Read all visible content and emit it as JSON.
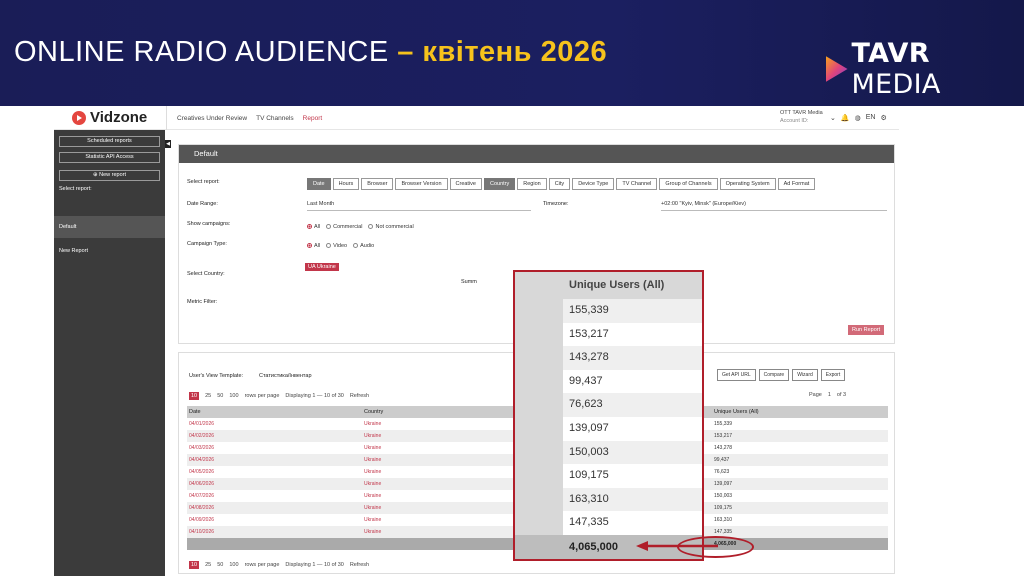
{
  "slide": {
    "title_main": "ONLINE RADIO AUDIENCE",
    "title_accent": "– квітень 2026",
    "brand_bold": "TAVR",
    "brand_light": "MEDIA",
    "colors": {
      "header_bg": "#1b1f60",
      "accent": "#f6c21c",
      "highlight": "#b01e2a"
    }
  },
  "app": {
    "logo": "Vidzone",
    "nav": [
      "Creatives Under Review",
      "TV Channels",
      "Report"
    ],
    "nav_active": "Report",
    "account_name": "OTT TAVR Media",
    "account_sub": "Account ID:",
    "lang": "EN",
    "icons": [
      "chevron-down-icon",
      "bell-icon",
      "globe-icon",
      "gear-icon"
    ]
  },
  "sidebar": {
    "buttons": [
      "Scheduled reports",
      "Statistic API Access",
      "⊕ New report"
    ],
    "select_label": "Select report:",
    "items": [
      "Default",
      "New Report"
    ]
  },
  "report": {
    "title": "Default",
    "select_report_label": "Select report:",
    "dimensions": [
      "Date",
      "Hours",
      "Browser",
      "Browser Version",
      "Creative",
      "Country",
      "Region",
      "City",
      "Device Type",
      "TV Channel",
      "Group of Channels",
      "Operating System",
      "Ad Format"
    ],
    "active_dimensions": [
      "Date",
      "Country"
    ],
    "date_range_label": "Date Range:",
    "date_range_value": "Last Month",
    "timezone_label": "Timezone:",
    "timezone_value": "+02:00 \"Kyiv, Minsk\" (Europe/Kiev)",
    "show_campaigns_label": "Show campaigns:",
    "show_campaigns_options": [
      "All",
      "Commercial",
      "Not commercial"
    ],
    "campaign_type_label": "Campaign Type:",
    "campaign_type_options": [
      "All",
      "Video",
      "Audio"
    ],
    "select_country_label": "Select Country:",
    "country_tag": "UA Ukraine",
    "summ_label": "Summ",
    "metric_filter_label": "Metric Filter:",
    "run_button": "Run Report"
  },
  "table": {
    "template_label": "User's View Template:",
    "template_value": "Статистика/Інвентар",
    "toolbar": [
      "Get API URL",
      "Compare",
      "Wizard",
      "Export"
    ],
    "page_sizes": [
      "10",
      "25",
      "50",
      "100"
    ],
    "page_size_selected": "10",
    "rows_per_page": "rows per page",
    "displaying": "Displaying 1 — 10 of 30",
    "refresh": "Refresh",
    "page_label": "Page",
    "page_current": "1",
    "page_total": "of 3",
    "columns": [
      "Date",
      "Country",
      "Unique Users (All)"
    ],
    "rows": [
      [
        "04/01/2026",
        "Ukraine",
        "155,339"
      ],
      [
        "04/02/2026",
        "Ukraine",
        "153,217"
      ],
      [
        "04/03/2026",
        "Ukraine",
        "143,278"
      ],
      [
        "04/04/2026",
        "Ukraine",
        "99,437"
      ],
      [
        "04/05/2026",
        "Ukraine",
        "76,623"
      ],
      [
        "04/06/2026",
        "Ukraine",
        "139,097"
      ],
      [
        "04/07/2026",
        "Ukraine",
        "150,003"
      ],
      [
        "04/08/2026",
        "Ukraine",
        "109,175"
      ],
      [
        "04/09/2026",
        "Ukraine",
        "163,310"
      ],
      [
        "04/10/2026",
        "Ukraine",
        "147,335"
      ]
    ],
    "total": "4,065,000"
  },
  "zoom": {
    "header": "Unique Users (All)",
    "values": [
      "155,339",
      "153,217",
      "143,278",
      "99,437",
      "76,623",
      "139,097",
      "150,003",
      "109,175",
      "163,310",
      "147,335"
    ],
    "total": "4,065,000"
  }
}
